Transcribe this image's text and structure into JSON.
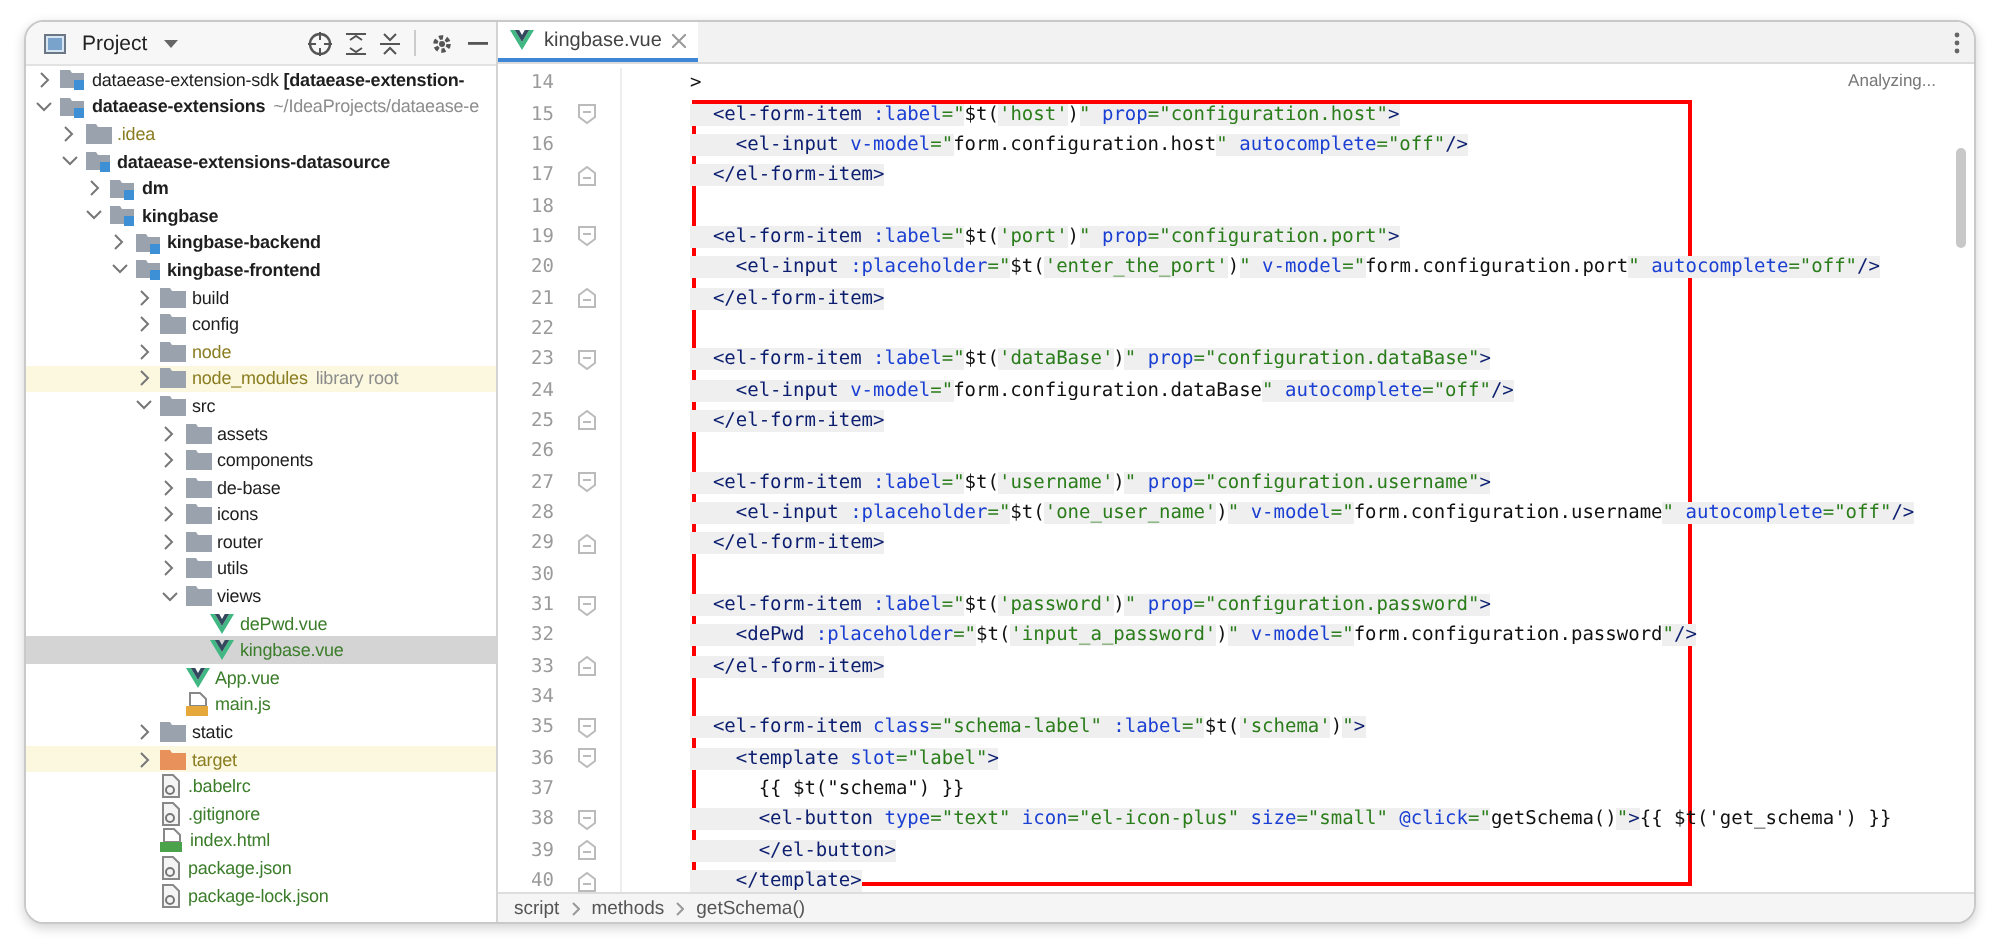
{
  "project_panel": {
    "title": "Project"
  },
  "tree": {
    "items": [
      {
        "name": "dataease-extension-sdk **[dataease-extenstion-**",
        "kind": "module",
        "bold": false,
        "expanded": false,
        "selected": false,
        "excluded": false,
        "added": false,
        "ignored": false
      },
      {
        "name": "dataease-extensions",
        "hint": "~/IdeaProjects/dataease-e",
        "kind": "module",
        "bold": true,
        "expanded": true,
        "selected": false,
        "excluded": false,
        "added": false,
        "ignored": false,
        "children": [
          {
            "name": ".idea",
            "kind": "folder",
            "bold": false,
            "expanded": false,
            "selected": false,
            "excluded": false,
            "added": false,
            "ignored": true
          },
          {
            "name": "dataease-extensions-datasource",
            "kind": "module",
            "bold": true,
            "expanded": true,
            "selected": false,
            "excluded": false,
            "added": false,
            "ignored": false,
            "children": [
              {
                "name": "dm",
                "kind": "module",
                "bold": true,
                "expanded": false,
                "selected": false,
                "excluded": false,
                "added": false,
                "ignored": false
              },
              {
                "name": "kingbase",
                "kind": "module",
                "bold": true,
                "expanded": true,
                "selected": false,
                "excluded": false,
                "added": false,
                "ignored": false,
                "children": [
                  {
                    "name": "kingbase-backend",
                    "kind": "module",
                    "bold": true,
                    "expanded": false,
                    "selected": false,
                    "excluded": false,
                    "added": false,
                    "ignored": false
                  },
                  {
                    "name": "kingbase-frontend",
                    "kind": "module",
                    "bold": true,
                    "expanded": true,
                    "selected": false,
                    "excluded": false,
                    "added": false,
                    "ignored": false,
                    "children": [
                      {
                        "name": "build",
                        "kind": "folder",
                        "bold": false,
                        "expanded": false,
                        "selected": false,
                        "excluded": false,
                        "added": false,
                        "ignored": false
                      },
                      {
                        "name": "config",
                        "kind": "folder",
                        "bold": false,
                        "expanded": false,
                        "selected": false,
                        "excluded": false,
                        "added": false,
                        "ignored": false
                      },
                      {
                        "name": "node",
                        "kind": "folder",
                        "bold": false,
                        "expanded": false,
                        "selected": false,
                        "excluded": false,
                        "added": false,
                        "ignored": true
                      },
                      {
                        "name": "node_modules",
                        "hint": "library root",
                        "kind": "folder",
                        "bold": false,
                        "expanded": false,
                        "selected": false,
                        "excluded": true,
                        "added": false,
                        "ignored": true
                      },
                      {
                        "name": "src",
                        "kind": "folder",
                        "bold": false,
                        "expanded": true,
                        "selected": false,
                        "excluded": false,
                        "added": false,
                        "ignored": false,
                        "children": [
                          {
                            "name": "assets",
                            "kind": "folder",
                            "bold": false,
                            "expanded": false,
                            "selected": false,
                            "excluded": false,
                            "added": false,
                            "ignored": false
                          },
                          {
                            "name": "components",
                            "kind": "folder",
                            "bold": false,
                            "expanded": false,
                            "selected": false,
                            "excluded": false,
                            "added": false,
                            "ignored": false
                          },
                          {
                            "name": "de-base",
                            "kind": "folder",
                            "bold": false,
                            "expanded": false,
                            "selected": false,
                            "excluded": false,
                            "added": false,
                            "ignored": false
                          },
                          {
                            "name": "icons",
                            "kind": "folder",
                            "bold": false,
                            "expanded": false,
                            "selected": false,
                            "excluded": false,
                            "added": false,
                            "ignored": false
                          },
                          {
                            "name": "router",
                            "kind": "folder",
                            "bold": false,
                            "expanded": false,
                            "selected": false,
                            "excluded": false,
                            "added": false,
                            "ignored": false
                          },
                          {
                            "name": "utils",
                            "kind": "folder",
                            "bold": false,
                            "expanded": false,
                            "selected": false,
                            "excluded": false,
                            "added": false,
                            "ignored": false
                          },
                          {
                            "name": "views",
                            "kind": "folder",
                            "bold": false,
                            "expanded": true,
                            "selected": false,
                            "excluded": false,
                            "added": false,
                            "ignored": false,
                            "children": [
                              {
                                "name": "dePwd.vue",
                                "kind": "vue",
                                "bold": false,
                                "selected": false,
                                "excluded": false,
                                "added": true,
                                "ignored": false
                              },
                              {
                                "name": "kingbase.vue",
                                "kind": "vue",
                                "bold": false,
                                "selected": true,
                                "excluded": false,
                                "added": true,
                                "ignored": false
                              }
                            ]
                          },
                          {
                            "name": "App.vue",
                            "kind": "vue",
                            "bold": false,
                            "selected": false,
                            "excluded": false,
                            "added": true,
                            "ignored": false
                          },
                          {
                            "name": "main.js",
                            "kind": "js",
                            "bold": false,
                            "selected": false,
                            "excluded": false,
                            "added": true,
                            "ignored": false
                          }
                        ]
                      },
                      {
                        "name": "static",
                        "kind": "folder",
                        "bold": false,
                        "expanded": false,
                        "selected": false,
                        "excluded": false,
                        "added": false,
                        "ignored": false
                      },
                      {
                        "name": "target",
                        "kind": "output-folder",
                        "bold": false,
                        "expanded": false,
                        "selected": false,
                        "excluded": true,
                        "added": false,
                        "ignored": true
                      },
                      {
                        "name": ".babelrc",
                        "kind": "config",
                        "bold": false,
                        "selected": false,
                        "excluded": false,
                        "added": true,
                        "ignored": false
                      },
                      {
                        "name": ".gitignore",
                        "kind": "config",
                        "bold": false,
                        "selected": false,
                        "excluded": false,
                        "added": true,
                        "ignored": false
                      },
                      {
                        "name": "index.html",
                        "kind": "html",
                        "bold": false,
                        "selected": false,
                        "excluded": false,
                        "added": true,
                        "ignored": false
                      },
                      {
                        "name": "package.json",
                        "kind": "config",
                        "bold": false,
                        "selected": false,
                        "excluded": false,
                        "added": true,
                        "ignored": false
                      },
                      {
                        "name": "package-lock.json",
                        "kind": "config",
                        "bold": false,
                        "selected": false,
                        "excluded": false,
                        "added": true,
                        "ignored": false
                      }
                    ]
                  }
                ]
              }
            ]
          }
        ]
      }
    ]
  },
  "editor": {
    "tabs": [
      {
        "label": "kingbase.vue",
        "selected": true
      }
    ],
    "status": "Analyzing...",
    "lines": [
      {
        "number": "14",
        "fold_start": false,
        "fold_end": false,
        "tokens": [
          {
            "kind": "text",
            "text": ">"
          }
        ]
      },
      {
        "number": "15",
        "fold_start": true,
        "fold_end": false,
        "tokens": [
          {
            "kind": "tag",
            "text": "  <el-form-item"
          },
          {
            "kind": "attr",
            "text": " :label"
          },
          {
            "kind": "str",
            "text": "=\""
          },
          {
            "kind": "text",
            "text": "$t("
          },
          {
            "kind": "str",
            "text": "'host'"
          },
          {
            "kind": "text",
            "text": ")"
          },
          {
            "kind": "str",
            "text": "\""
          },
          {
            "kind": "attr",
            "text": " prop"
          },
          {
            "kind": "str",
            "text": "=\"configuration.host\""
          },
          {
            "kind": "tag",
            "text": ">"
          }
        ]
      },
      {
        "number": "16",
        "fold_start": false,
        "fold_end": false,
        "tokens": [
          {
            "kind": "tag",
            "text": "    <el-input"
          },
          {
            "kind": "attr",
            "text": " v-model"
          },
          {
            "kind": "str",
            "text": "=\""
          },
          {
            "kind": "text",
            "text": "form.configuration.host"
          },
          {
            "kind": "str",
            "text": "\""
          },
          {
            "kind": "attr",
            "text": " autocomplete"
          },
          {
            "kind": "str",
            "text": "=\"off\""
          },
          {
            "kind": "tag",
            "text": "/>"
          }
        ]
      },
      {
        "number": "17",
        "fold_start": false,
        "fold_end": true,
        "tokens": [
          {
            "kind": "tag",
            "text": "  </el-form-item>"
          }
        ]
      },
      {
        "number": "18",
        "fold_start": false,
        "fold_end": false
      },
      {
        "number": "19",
        "fold_start": true,
        "fold_end": false,
        "tokens": [
          {
            "kind": "tag",
            "text": "  <el-form-item"
          },
          {
            "kind": "attr",
            "text": " :label"
          },
          {
            "kind": "str",
            "text": "=\""
          },
          {
            "kind": "text",
            "text": "$t("
          },
          {
            "kind": "str",
            "text": "'port'"
          },
          {
            "kind": "text",
            "text": ")"
          },
          {
            "kind": "str",
            "text": "\""
          },
          {
            "kind": "attr",
            "text": " prop"
          },
          {
            "kind": "str",
            "text": "=\"configuration.port\""
          },
          {
            "kind": "tag",
            "text": ">"
          }
        ]
      },
      {
        "number": "20",
        "fold_start": false,
        "fold_end": false,
        "tokens": [
          {
            "kind": "tag",
            "text": "    <el-input"
          },
          {
            "kind": "attr",
            "text": " :placeholder"
          },
          {
            "kind": "str",
            "text": "=\""
          },
          {
            "kind": "text",
            "text": "$t("
          },
          {
            "kind": "str",
            "text": "'enter_the_port'"
          },
          {
            "kind": "text",
            "text": ")"
          },
          {
            "kind": "str",
            "text": "\""
          },
          {
            "kind": "attr",
            "text": " v-model"
          },
          {
            "kind": "str",
            "text": "=\""
          },
          {
            "kind": "text",
            "text": "form.configuration.port"
          },
          {
            "kind": "str",
            "text": "\""
          },
          {
            "kind": "attr",
            "text": " autocomplete"
          },
          {
            "kind": "str",
            "text": "=\"off\""
          },
          {
            "kind": "tag",
            "text": "/>"
          }
        ]
      },
      {
        "number": "21",
        "fold_start": false,
        "fold_end": true,
        "tokens": [
          {
            "kind": "tag",
            "text": "  </el-form-item>"
          }
        ]
      },
      {
        "number": "22",
        "fold_start": false,
        "fold_end": false
      },
      {
        "number": "23",
        "fold_start": true,
        "fold_end": false,
        "tokens": [
          {
            "kind": "tag",
            "text": "  <el-form-item"
          },
          {
            "kind": "attr",
            "text": " :label"
          },
          {
            "kind": "str",
            "text": "=\""
          },
          {
            "kind": "text",
            "text": "$t("
          },
          {
            "kind": "str",
            "text": "'dataBase'"
          },
          {
            "kind": "text",
            "text": ")"
          },
          {
            "kind": "str",
            "text": "\""
          },
          {
            "kind": "attr",
            "text": " prop"
          },
          {
            "kind": "str",
            "text": "=\"configuration.dataBase\""
          },
          {
            "kind": "tag",
            "text": ">"
          }
        ]
      },
      {
        "number": "24",
        "fold_start": false,
        "fold_end": false,
        "tokens": [
          {
            "kind": "tag",
            "text": "    <el-input"
          },
          {
            "kind": "attr",
            "text": " v-model"
          },
          {
            "kind": "str",
            "text": "=\""
          },
          {
            "kind": "text",
            "text": "form.configuration.dataBase"
          },
          {
            "kind": "str",
            "text": "\""
          },
          {
            "kind": "attr",
            "text": " autocomplete"
          },
          {
            "kind": "str",
            "text": "=\"off\""
          },
          {
            "kind": "tag",
            "text": "/>"
          }
        ]
      },
      {
        "number": "25",
        "fold_start": false,
        "fold_end": true,
        "tokens": [
          {
            "kind": "tag",
            "text": "  </el-form-item>"
          }
        ]
      },
      {
        "number": "26",
        "fold_start": false,
        "fold_end": false
      },
      {
        "number": "27",
        "fold_start": true,
        "fold_end": false,
        "tokens": [
          {
            "kind": "tag",
            "text": "  <el-form-item"
          },
          {
            "kind": "attr",
            "text": " :label"
          },
          {
            "kind": "str",
            "text": "=\""
          },
          {
            "kind": "text",
            "text": "$t("
          },
          {
            "kind": "str",
            "text": "'username'"
          },
          {
            "kind": "text",
            "text": ")"
          },
          {
            "kind": "str",
            "text": "\""
          },
          {
            "kind": "attr",
            "text": " prop"
          },
          {
            "kind": "str",
            "text": "=\"configuration.username\""
          },
          {
            "kind": "tag",
            "text": ">"
          }
        ]
      },
      {
        "number": "28",
        "fold_start": false,
        "fold_end": false,
        "tokens": [
          {
            "kind": "tag",
            "text": "    <el-input"
          },
          {
            "kind": "attr",
            "text": " :placeholder"
          },
          {
            "kind": "str",
            "text": "=\""
          },
          {
            "kind": "text",
            "text": "$t("
          },
          {
            "kind": "str",
            "text": "'one_user_name'"
          },
          {
            "kind": "text",
            "text": ")"
          },
          {
            "kind": "str",
            "text": "\""
          },
          {
            "kind": "attr",
            "text": " v-model"
          },
          {
            "kind": "str",
            "text": "=\""
          },
          {
            "kind": "text",
            "text": "form.configuration.username"
          },
          {
            "kind": "str",
            "text": "\""
          },
          {
            "kind": "attr",
            "text": " autocomplete"
          },
          {
            "kind": "str",
            "text": "=\"off\""
          },
          {
            "kind": "tag",
            "text": "/>"
          }
        ]
      },
      {
        "number": "29",
        "fold_start": false,
        "fold_end": true,
        "tokens": [
          {
            "kind": "tag",
            "text": "  </el-form-item>"
          }
        ]
      },
      {
        "number": "30",
        "fold_start": false,
        "fold_end": false
      },
      {
        "number": "31",
        "fold_start": true,
        "fold_end": false,
        "tokens": [
          {
            "kind": "tag",
            "text": "  <el-form-item"
          },
          {
            "kind": "attr",
            "text": " :label"
          },
          {
            "kind": "str",
            "text": "=\""
          },
          {
            "kind": "text",
            "text": "$t("
          },
          {
            "kind": "str",
            "text": "'password'"
          },
          {
            "kind": "text",
            "text": ")"
          },
          {
            "kind": "str",
            "text": "\""
          },
          {
            "kind": "attr",
            "text": " prop"
          },
          {
            "kind": "str",
            "text": "=\"configuration.password\""
          },
          {
            "kind": "tag",
            "text": ">"
          }
        ]
      },
      {
        "number": "32",
        "fold_start": false,
        "fold_end": false,
        "tokens": [
          {
            "kind": "tag",
            "text": "    <dePwd"
          },
          {
            "kind": "attr",
            "text": " :placeholder"
          },
          {
            "kind": "str",
            "text": "=\""
          },
          {
            "kind": "text",
            "text": "$t("
          },
          {
            "kind": "str",
            "text": "'input_a_password'"
          },
          {
            "kind": "text",
            "text": ")"
          },
          {
            "kind": "str",
            "text": "\""
          },
          {
            "kind": "attr",
            "text": " v-model"
          },
          {
            "kind": "str",
            "text": "=\""
          },
          {
            "kind": "text",
            "text": "form.configuration.password"
          },
          {
            "kind": "str",
            "text": "\""
          },
          {
            "kind": "tag",
            "text": "/>"
          }
        ]
      },
      {
        "number": "33",
        "fold_start": false,
        "fold_end": true,
        "tokens": [
          {
            "kind": "tag",
            "text": "  </el-form-item>"
          }
        ]
      },
      {
        "number": "34",
        "fold_start": false,
        "fold_end": false
      },
      {
        "number": "35",
        "fold_start": true,
        "fold_end": false,
        "tokens": [
          {
            "kind": "tag",
            "text": "  <el-form-item"
          },
          {
            "kind": "attr",
            "text": " class"
          },
          {
            "kind": "str",
            "text": "=\"schema-label\""
          },
          {
            "kind": "attr",
            "text": " :label"
          },
          {
            "kind": "str",
            "text": "=\""
          },
          {
            "kind": "text",
            "text": "$t("
          },
          {
            "kind": "str",
            "text": "'schema'"
          },
          {
            "kind": "text",
            "text": ")"
          },
          {
            "kind": "str",
            "text": "\""
          },
          {
            "kind": "tag",
            "text": ">"
          }
        ]
      },
      {
        "number": "36",
        "fold_start": true,
        "fold_end": false,
        "tokens": [
          {
            "kind": "tag",
            "text": "    <template"
          },
          {
            "kind": "attr",
            "text": " slot"
          },
          {
            "kind": "str",
            "text": "=\"label\""
          },
          {
            "kind": "tag",
            "text": ">"
          }
        ]
      },
      {
        "number": "37",
        "fold_start": false,
        "fold_end": false,
        "tokens": [
          {
            "kind": "text",
            "text": "      {{ $t(\"schema\") }}"
          }
        ]
      },
      {
        "number": "38",
        "fold_start": true,
        "fold_end": false,
        "tokens": [
          {
            "kind": "tag",
            "text": "      <el-button"
          },
          {
            "kind": "attr",
            "text": " type"
          },
          {
            "kind": "str",
            "text": "=\"text\""
          },
          {
            "kind": "attr",
            "text": " icon"
          },
          {
            "kind": "str",
            "text": "=\"el-icon-plus\""
          },
          {
            "kind": "attr",
            "text": " size"
          },
          {
            "kind": "str",
            "text": "=\"small\""
          },
          {
            "kind": "attr",
            "text": " @click"
          },
          {
            "kind": "str",
            "text": "=\""
          },
          {
            "kind": "text",
            "text": "getSchema()"
          },
          {
            "kind": "str",
            "text": "\""
          },
          {
            "kind": "tag",
            "text": ">"
          },
          {
            "kind": "text",
            "text": "{{ $t('get_schema') }}"
          }
        ]
      },
      {
        "number": "39",
        "fold_start": false,
        "fold_end": true,
        "tokens": [
          {
            "kind": "tag",
            "text": "      </el-button>"
          }
        ]
      },
      {
        "number": "40",
        "fold_start": false,
        "fold_end": true,
        "tokens": [
          {
            "kind": "tag",
            "text": "    </template>"
          }
        ]
      }
    ]
  },
  "breadcrumb": [
    "script",
    "methods",
    "getSchema()"
  ]
}
